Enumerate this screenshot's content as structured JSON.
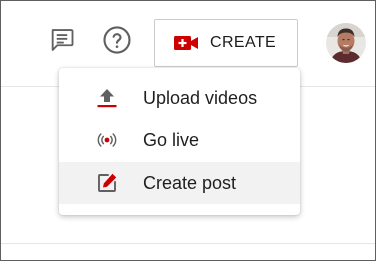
{
  "header": {
    "create_button": {
      "label": "CREATE",
      "icon": "video-camera-plus-icon",
      "icon_color": "#cc0000"
    },
    "feedback_icon": "message-square-icon",
    "help_icon": "help-circle-icon",
    "avatar": "user-avatar"
  },
  "create_menu": {
    "items": [
      {
        "label": "Upload videos",
        "icon": "upload-icon",
        "icon_color": "#cc0000"
      },
      {
        "label": "Go live",
        "icon": "broadcast-icon",
        "icon_color": "#cc0000"
      },
      {
        "label": "Create post",
        "icon": "edit-square-icon",
        "icon_color": "#cc0000",
        "highlighted": true
      }
    ]
  }
}
